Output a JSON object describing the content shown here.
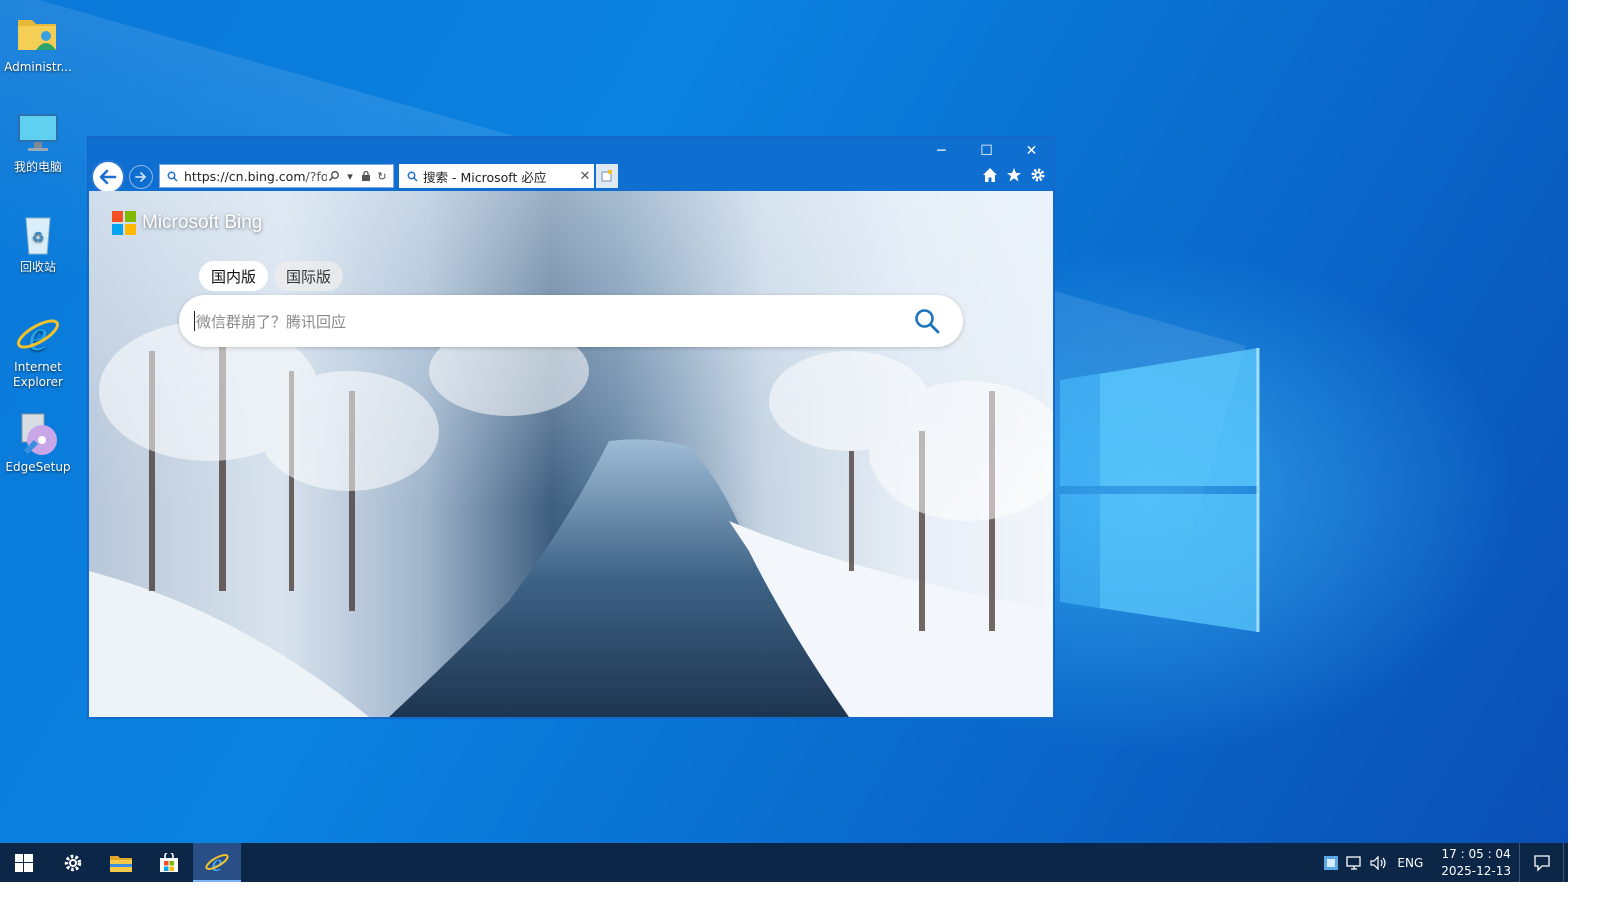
{
  "desktop": {
    "icons": [
      {
        "label": "Administr...",
        "icon": "user-folder-icon"
      },
      {
        "label": "我的电脑",
        "icon": "computer-icon"
      },
      {
        "label": "回收站",
        "icon": "recycle-bin-icon"
      },
      {
        "label": "Internet Explorer",
        "icon": "internet-explorer-icon"
      },
      {
        "label": "EdgeSetup",
        "icon": "installer-disc-icon"
      }
    ]
  },
  "browser": {
    "address": {
      "host": "https://cn.bing.com",
      "path": "/?forr"
    },
    "tab": {
      "title": "搜索 - Microsoft 必应"
    },
    "window_controls": {
      "minimize": "─",
      "maximize": "☐",
      "close": "✕"
    },
    "colors": {
      "frame": "#0f6fd0",
      "accent": "#2b76d2"
    }
  },
  "bing": {
    "logo_text": "Microsoft Bing",
    "scopes": [
      {
        "label": "国内版",
        "active": true
      },
      {
        "label": "国际版",
        "active": false
      }
    ],
    "search_placeholder": "微信群崩了？腾讯回应",
    "search_icon_color": "#1c75bc"
  },
  "taskbar": {
    "pinned": [
      "start-icon",
      "settings-icon",
      "file-explorer-icon",
      "store-icon",
      "internet-explorer-icon"
    ],
    "active_app": "internet-explorer-icon",
    "language": "ENG",
    "time": "17 : 05 : 04",
    "date": "2025-12-13"
  }
}
